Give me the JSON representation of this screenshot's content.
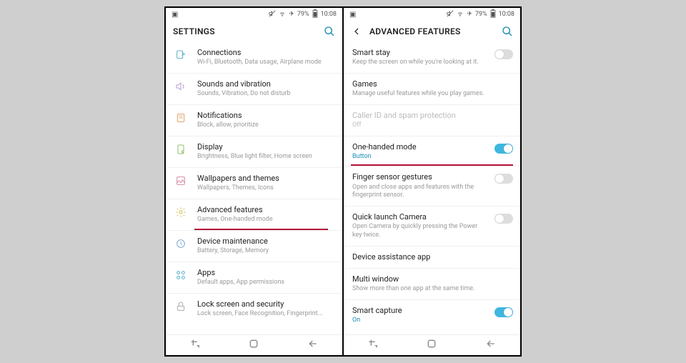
{
  "status": {
    "battery": "79%",
    "time": "10:08"
  },
  "screen1": {
    "title": "SETTINGS",
    "items": [
      {
        "title": "Connections",
        "sub": "Wi-Fi, Bluetooth, Data usage, Airplane mode"
      },
      {
        "title": "Sounds and vibration",
        "sub": "Sounds, Vibration, Do not disturb"
      },
      {
        "title": "Notifications",
        "sub": "Block, allow, prioritize"
      },
      {
        "title": "Display",
        "sub": "Brightness, Blue light filter, Home screen"
      },
      {
        "title": "Wallpapers and themes",
        "sub": "Wallpapers, Themes, Icons"
      },
      {
        "title": "Advanced features",
        "sub": "Games, One-handed mode"
      },
      {
        "title": "Device maintenance",
        "sub": "Battery, Storage, Memory"
      },
      {
        "title": "Apps",
        "sub": "Default apps, App permissions"
      },
      {
        "title": "Lock screen and security",
        "sub": "Lock screen, Face Recognition, Fingerprint..."
      }
    ]
  },
  "screen2": {
    "title": "ADVANCED FEATURES",
    "items": [
      {
        "title": "Smart stay",
        "sub": "Keep the screen on while you're looking at it.",
        "toggle": "off"
      },
      {
        "title": "Games",
        "sub": "Manage useful features while you play games."
      },
      {
        "title": "Caller ID and spam protection",
        "sub": "Off",
        "disabled": true
      },
      {
        "title": "One-handed mode",
        "value": "Button",
        "toggle": "on",
        "highlight": true
      },
      {
        "title": "Finger sensor gestures",
        "sub": "Open and close apps and features with the fingerprint sensor.",
        "toggle": "off"
      },
      {
        "title": "Quick launch Camera",
        "sub": "Open Camera by quickly pressing the Power key twice.",
        "toggle": "off"
      },
      {
        "title": "Device assistance app"
      },
      {
        "title": "Multi window",
        "sub": "Show more than one app at the same time."
      },
      {
        "title": "Smart capture",
        "value": "On",
        "toggle": "on"
      }
    ]
  }
}
